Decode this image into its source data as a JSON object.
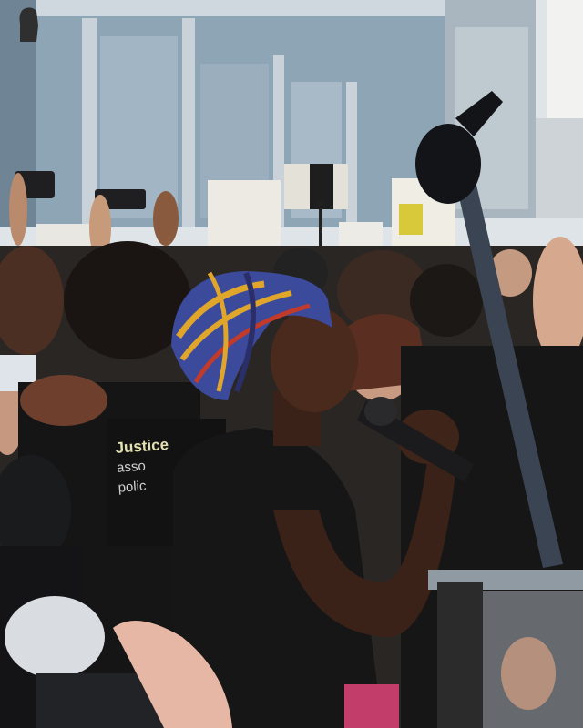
{
  "scene": {
    "description_tags": [
      "photo",
      "protest",
      "speaker-with-microphone"
    ],
    "colors": {
      "sky": "#e9ecef",
      "building_glass": "#8ea5b6",
      "building_frame": "#d6dde2",
      "shirt": "#161616",
      "headwrap_blue": "#3b4a9a",
      "headwrap_gold": "#e0a62b",
      "boom_pole": "#3a4452",
      "sign": "#f0ede4",
      "sign_yellow": "#d8c93a"
    }
  },
  "shirt_print": {
    "line1": "Justice",
    "line2": "",
    "line3": "asso",
    "line4": "polic"
  }
}
